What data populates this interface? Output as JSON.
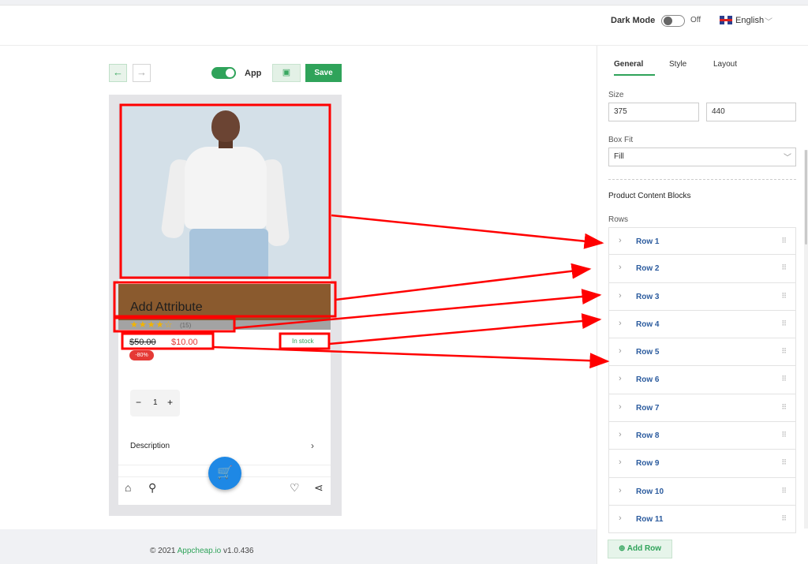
{
  "header": {
    "dark_mode_label": "Dark Mode",
    "dark_mode_state": "Off",
    "language": "English"
  },
  "toolbar": {
    "app_label": "App",
    "save_label": "Save"
  },
  "product": {
    "attribute_text": "Add Attribute",
    "rating_count": "(15)",
    "old_price": "$50.00",
    "new_price": "$10.00",
    "stock": "In stock",
    "discount": "-80%",
    "quantity": "1",
    "description_label": "Description"
  },
  "sidebar": {
    "tabs": [
      "General",
      "Style",
      "Layout"
    ],
    "size_label": "Size",
    "size_width": "375",
    "size_height": "440",
    "box_fit_label": "Box Fit",
    "box_fit_value": "Fill",
    "section_title": "Product Content Blocks",
    "rows_label": "Rows",
    "rows": [
      "Row 1",
      "Row 2",
      "Row 3",
      "Row 4",
      "Row 5",
      "Row 6",
      "Row 7",
      "Row 8",
      "Row 9",
      "Row 10",
      "Row 11"
    ],
    "add_row_label": "Add Row"
  },
  "footer": {
    "copyright": "© 2021",
    "brand": "Appcheap.io",
    "version": "v1.0.436"
  },
  "colors": {
    "accent": "#2fa35a",
    "annotation": "#ff0000",
    "price": "#e53935",
    "fab": "#1e88e5"
  }
}
